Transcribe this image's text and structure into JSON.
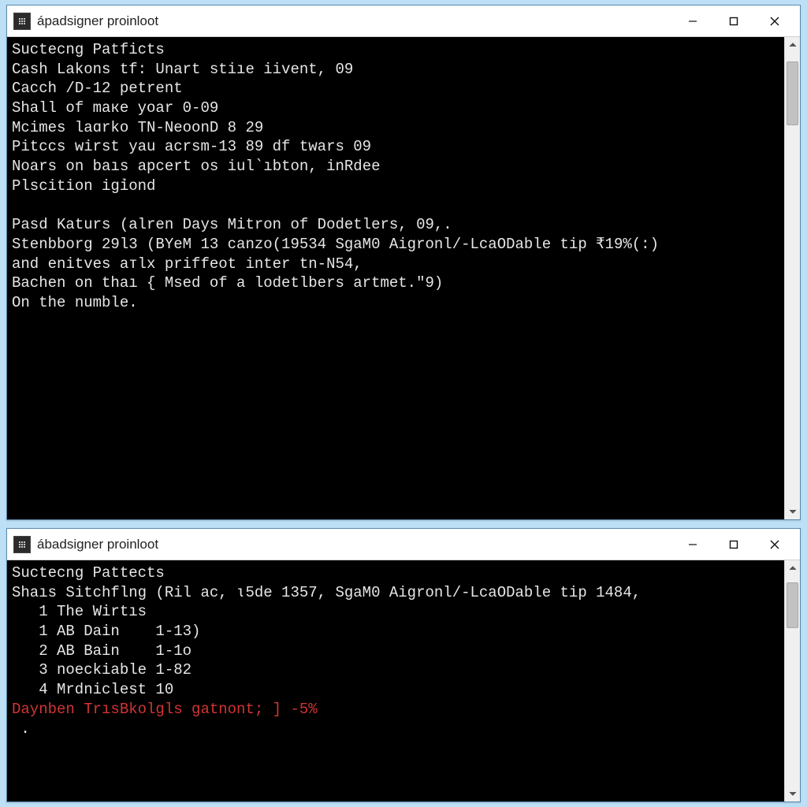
{
  "windows": [
    {
      "title": "ápadsigner proinloot",
      "scroll_thumb": {
        "top_pct": 2,
        "height_pct": 14
      },
      "lines": [
        {
          "text": "Suctecng Patficts"
        },
        {
          "text": "Cash Lakons tf: Unart stiıe iivent, 09"
        },
        {
          "text": "Cacch /D-12 petrent"
        },
        {
          "text": "Shall of maкe yoar 0-09"
        },
        {
          "text": "Mcimes laɑrko TN-NeoonD 8 29"
        },
        {
          "text": "Pitccs wirst yau acrsm-13 89 df twars 09"
        },
        {
          "text": "Noars on baıs apcert os iul՝ıbton, inRdee"
        },
        {
          "text": "Plscition igỉond"
        },
        {
          "text": ""
        },
        {
          "text": "Pasd Katurs (alren Days Mitron of Dodetlers, 09,."
        },
        {
          "text": "Stenbborg 29l3 (BYeM 13 canzo(19534 SgaM0 Aigronl/-LcaODable tip ₹19%(:)"
        },
        {
          "text": "and enitves aᴛlx priffeot inter tn-N54,"
        },
        {
          "text": "Bachen on thaı { Msed of a lodetlbers artmet.\"9)"
        },
        {
          "text": "On the numble."
        }
      ]
    },
    {
      "title": "ábadsigner proinloot",
      "scroll_thumb": {
        "top_pct": 3,
        "height_pct": 22
      },
      "lines": [
        {
          "text": "Suctecng Pattects"
        },
        {
          "text": "Shaıs Sitchflng (Ril ac, ɩ5de 1357, SgaM0 Aigronl/-LcaODable tip 1484,"
        },
        {
          "text": "1 The Wirtıs",
          "indent": true
        },
        {
          "text": "1 AB Dain    1-13)",
          "indent": true
        },
        {
          "text": "2 AB Bain    1-1o",
          "indent": true
        },
        {
          "text": "3 noeckiable 1-82",
          "indent": true
        },
        {
          "text": "4 Mrdniclest 10",
          "indent": true
        },
        {
          "text": "Daynben TrısBkolgls gatnont; ] -5%",
          "red": true
        },
        {
          "text": " ."
        }
      ]
    }
  ]
}
